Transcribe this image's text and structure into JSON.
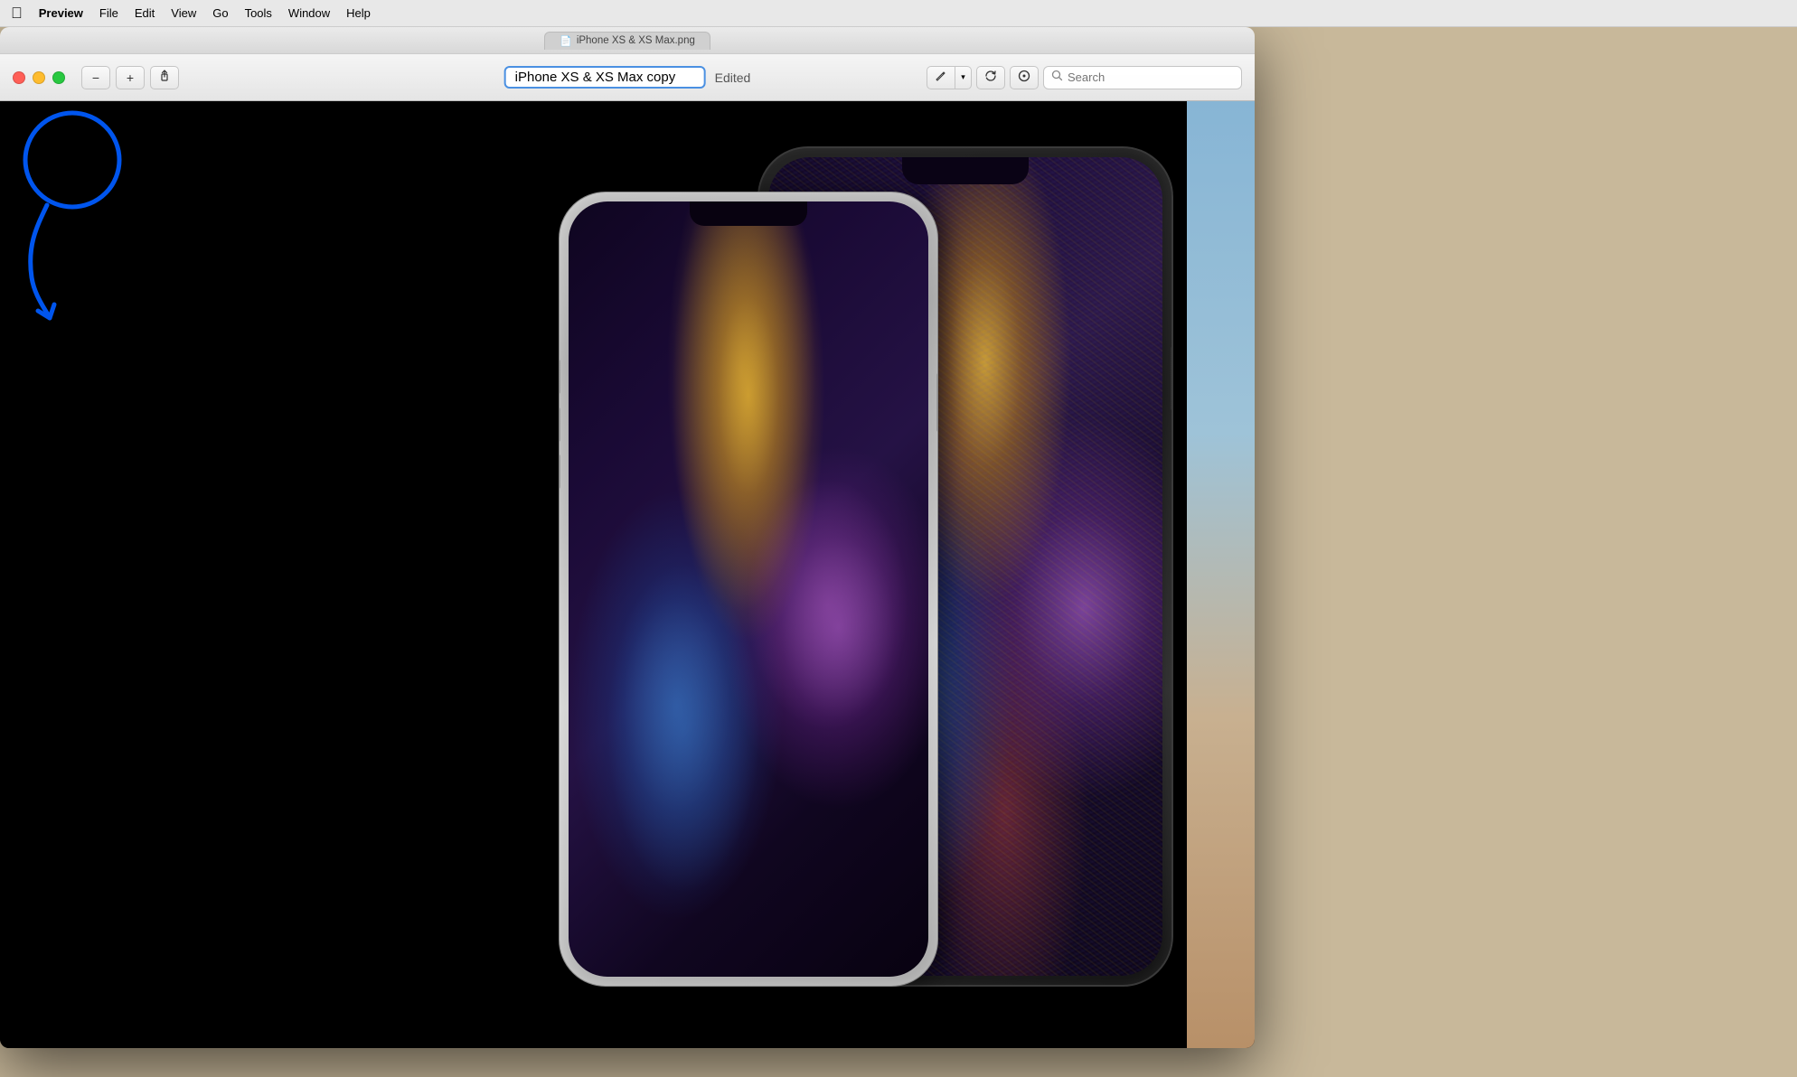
{
  "menubar": {
    "apple": "🍎",
    "items": [
      {
        "label": "Preview"
      },
      {
        "label": "File"
      },
      {
        "label": "Edit"
      },
      {
        "label": "View"
      },
      {
        "label": "Go"
      },
      {
        "label": "Tools"
      },
      {
        "label": "Window"
      },
      {
        "label": "Help"
      }
    ]
  },
  "titlebar": {
    "tab_filename": "iPhone XS & XS Max.png",
    "tab_icon": "📄"
  },
  "toolbar": {
    "zoom_out_label": "−",
    "zoom_in_label": "+",
    "share_label": "↑",
    "title_value": "iPhone XS & XS Max copy",
    "edited_label": "Edited",
    "markup_label": "✏️",
    "chevron_label": "▾",
    "rotate_label": "↩",
    "annotate_label": "◎",
    "search_placeholder": "Search"
  },
  "annotation": {
    "circle_color": "#0055ee",
    "arrow_color": "#0055ee",
    "points_to": "traffic-lights"
  },
  "image": {
    "description": "iPhone XS and XS Max product photo on black background",
    "background": "#000000"
  }
}
